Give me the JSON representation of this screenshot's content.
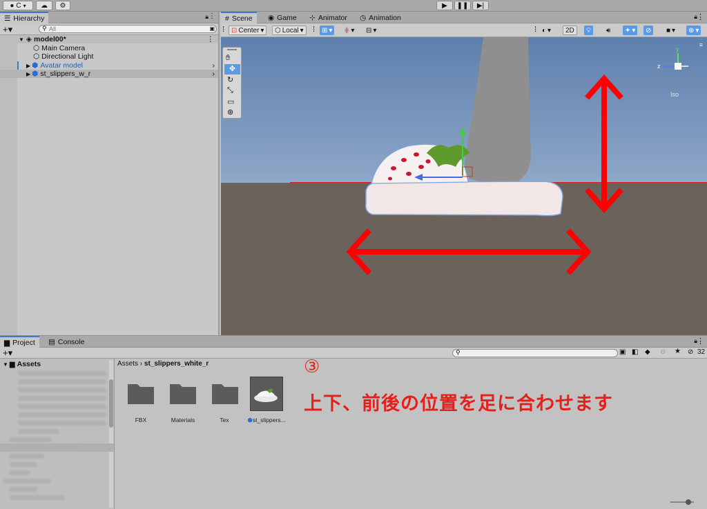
{
  "toolbar": {
    "account_label": "C",
    "account_icon": "account-icon",
    "cloud_icon": "cloud-icon",
    "settings_icon": "gear-icon",
    "play_icon": "play-icon",
    "pause_icon": "pause-icon",
    "step_icon": "step-icon"
  },
  "hierarchy": {
    "tab_label": "Hierarchy",
    "search_placeholder": "All",
    "items": [
      {
        "label": "model00*",
        "bold": true
      },
      {
        "label": "Main Camera"
      },
      {
        "label": "Directional Light"
      },
      {
        "label": "Avatar model",
        "color": "#1f5fbf"
      },
      {
        "label": "st_slippers_w_r"
      }
    ]
  },
  "scene": {
    "tabs": [
      {
        "label": "Scene"
      },
      {
        "label": "Game"
      },
      {
        "label": "Animator"
      },
      {
        "label": "Animation"
      }
    ],
    "pivot_label": "Center",
    "space_label": "Local",
    "mode_2d_label": "2D",
    "gizmo_label": "Iso",
    "gizmo_axes": {
      "y": "y",
      "z": "z"
    }
  },
  "project": {
    "tabs": [
      {
        "label": "Project"
      },
      {
        "label": "Console"
      }
    ],
    "count_label": "32",
    "tree_root": "Assets",
    "breadcrumb": {
      "root": "Assets",
      "current": "st_slippers_white_r"
    },
    "assets": [
      {
        "label": "FBX"
      },
      {
        "label": "Materials"
      },
      {
        "label": "Tex"
      },
      {
        "label": "st_slippers..."
      }
    ]
  },
  "annotation": {
    "step": "③",
    "text": "上下、前後の位置を足に合わせます",
    "color": "#e5201a"
  },
  "colors": {
    "accent": "#3a7ad6",
    "arrow": "#ff0000"
  }
}
